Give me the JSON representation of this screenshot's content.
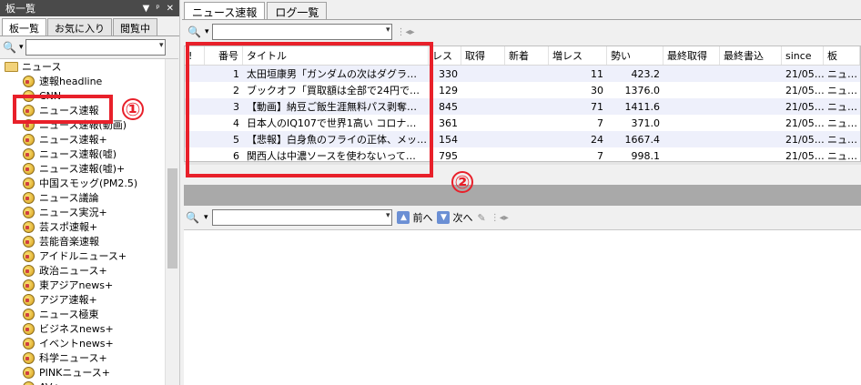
{
  "left_pane": {
    "title": "板一覧",
    "controls": [
      "▼",
      "ᵖ",
      "✕"
    ],
    "tabs": [
      {
        "label": "板一覧",
        "active": true
      },
      {
        "label": "お気に入り",
        "active": false
      },
      {
        "label": "閲覧中",
        "active": false
      }
    ],
    "search_value": "",
    "tree": {
      "root": "ニュース",
      "items": [
        "速報headline",
        "CNN",
        "ニュース速報",
        "ニュース速報(動画)",
        "ニュース速報+",
        "ニュース速報(嘘)",
        "ニュース速報(嘘)+",
        "中国スモッグ(PM2.5)",
        "ニュース議論",
        "ニュース実況+",
        "芸スポ速報+",
        "芸能音楽速報",
        "アイドルニュース+",
        "政治ニュース+",
        "東アジアnews+",
        "アジア速報+",
        "ニュース極東",
        "ビジネスnews+",
        "イベントnews+",
        "科学ニュース+",
        "PINKニュース+",
        "AV+"
      ]
    }
  },
  "right_pane": {
    "tabs": [
      {
        "label": "ニュース速報",
        "active": true
      },
      {
        "label": "ログ一覧",
        "active": false
      }
    ],
    "search_value": "",
    "columns": [
      "!",
      "番号",
      "タイトル",
      "レス",
      "取得",
      "新着",
      "増レス",
      "勢い",
      "最終取得",
      "最終書込",
      "since",
      "板"
    ],
    "rows": [
      {
        "no": "1",
        "title": "太田垣康男「ガンダムの次はダグラ…",
        "res": "330",
        "get": "",
        "new": "",
        "inc": "11",
        "mom": "423.2",
        "since": "21/05…",
        "board": "ニュ…"
      },
      {
        "no": "2",
        "title": "ブックオフ「買取額は全部で24円で…",
        "res": "129",
        "get": "",
        "new": "",
        "inc": "30",
        "mom": "1376.0",
        "since": "21/05…",
        "board": "ニュ…"
      },
      {
        "no": "3",
        "title": "【動画】納豆ご飯生涯無料パス剥奪…",
        "res": "845",
        "get": "",
        "new": "",
        "inc": "71",
        "mom": "1411.6",
        "since": "21/05…",
        "board": "ニュ…"
      },
      {
        "no": "4",
        "title": "日本人のIQ107で世界1高い コロナ…",
        "res": "361",
        "get": "",
        "new": "",
        "inc": "7",
        "mom": "371.0",
        "since": "21/05…",
        "board": "ニュ…"
      },
      {
        "no": "5",
        "title": "【悲報】白身魚のフライの正体、メッ…",
        "res": "154",
        "get": "",
        "new": "",
        "inc": "24",
        "mom": "1667.4",
        "since": "21/05…",
        "board": "ニュ…"
      },
      {
        "no": "6",
        "title": "関西人は中濃ソースを使わないって…",
        "res": "795",
        "get": "",
        "new": "",
        "inc": "7",
        "mom": "998.1",
        "since": "21/05…",
        "board": "ニュ…"
      }
    ],
    "lower_toolbar": {
      "search_value": "",
      "prev_label": "前へ",
      "next_label": "次へ"
    }
  },
  "annotations": {
    "marker1": "①",
    "marker2": "②"
  },
  "colors": {
    "annotation": "#e8202a",
    "even_row": "#eef0fb"
  }
}
